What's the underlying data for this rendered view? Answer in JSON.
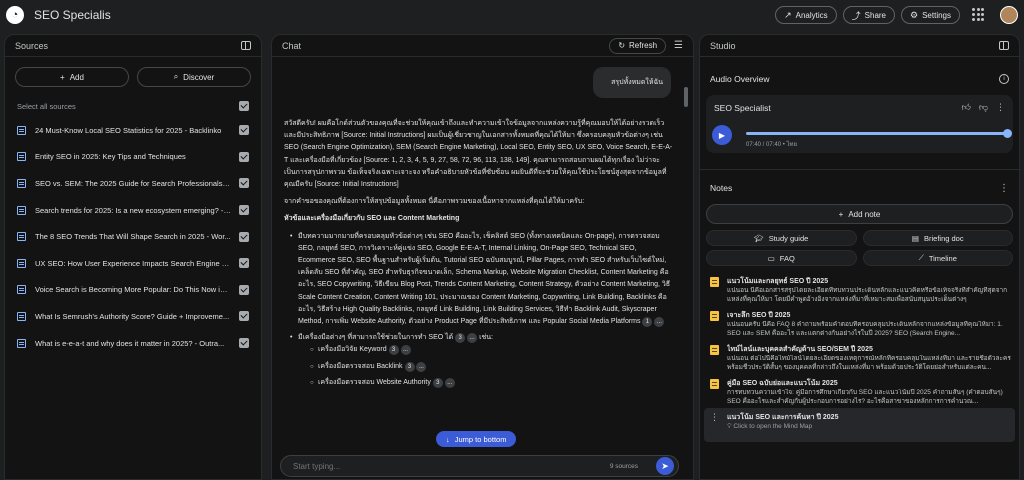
{
  "app": {
    "title": "SEO Specialis"
  },
  "topbar": {
    "analytics": "Analytics",
    "share": "Share",
    "settings": "Settings"
  },
  "sources": {
    "title": "Sources",
    "add_label": "Add",
    "discover_label": "Discover",
    "select_all": "Select all sources",
    "items": [
      "24 Must-Know Local SEO Statistics for 2025 - Backlinko",
      "Entity SEO in 2025: Key Tips and Techniques",
      "SEO vs. SEM: The 2025 Guide for Search Professionals - ...",
      "Search trends for 2025: Is a new ecosystem emerging? - ...",
      "The 8 SEO Trends That Will Shape Search in 2025 - Wor...",
      "UX SEO: How User Experience Impacts Search Engine R...",
      "Voice Search is Becoming More Popular: Do This Now in ...",
      "What Is Semrush's Authority Score? Guide + Improveme...",
      "What is e-e-a-t and why does it matter in 2025? - Outra..."
    ]
  },
  "chat": {
    "title": "Chat",
    "refresh": "Refresh",
    "user_message": "สรุปทั้งหมดให้ฉัน",
    "intro": "สวัสดีครับ! ผมคือโกด์ส่วนตัวของคุณที่จะช่วยให้คุณเข้าถึงและทำความเข้าใจข้อมูลจากแหล่งความรู้ที่คุณมอบให้ได้อย่างรวดเร็วและมีประสิทธิภาพ [Source: Initial Instructions] ผมเป็นผู้เชี่ยวชาญในเอกสารทั้งหมดที่คุณได้ให้มา ซึ่งครอบคลุมหัวข้อต่างๆ เช่น SEO (Search Engine Optimization), SEM (Search Engine Marketing), Local SEO, Entity SEO, UX SEO, Voice Search, E-E-A-T และเครื่องมือที่เกี่ยวข้อง [Source: 1, 2, 3, 4, 5, 9, 27, 58, 72, 96, 113, 138, 149]. คุณสามารถสอบถามผมได้ทุกเรื่อง ไม่ว่าจะเป็นการสรุปภาพรวม ข้อเท็จจริงเฉพาะเจาะจง หรือคำอธิบายหัวข้อที่ซับซ้อน ผมยินดีที่จะช่วยให้คุณใช้ประโยชน์สูงสุดจากข้อมูลที่คุณมีครับ [Source: Initial Instructions]",
    "summary_lead": "จากคำขอของคุณที่ต้องการให้สรุปข้อมูลทั้งหมด นี่คือภาพรวมของเนื้อหาจากแหล่งที่คุณได้ให้มาครับ:",
    "section_heading": "หัวข้อและเครื่องมือเกี่ยวกับ SEO และ Content Marketing",
    "bullet1": "มีบทความมากมายที่ครอบคลุมหัวข้อต่างๆ เช่น SEO คืออะไร, เช็คลิสต์ SEO (ทั้งทางเทคนิคและ On-page), การตรวจสอบ SEO, กลยุทธ์ SEO, การวิเคราะห์คู่แข่ง SEO, Google E-E-A-T, Internal Linking, On-Page SEO, Technical SEO, Ecommerce SEO, SEO พื้นฐานสำหรับผู้เริ่มต้น, Tutorial SEO ฉบับสมบูรณ์, Pillar Pages, การทำ SEO สำหรับเว็บไซต์ใหม่, เคล็ดลับ SEO ที่สำคัญ, SEO สำหรับธุรกิจขนาดเล็ก, Schema Markup, Website Migration Checklist, Content Marketing คืออะไร, SEO Copywriting, วิธีเขียน Blog Post, Trends Content Marketing, Content Strategy, ตัวอย่าง Content Marketing, วิธี Scale Content Creation, Content Writing 101, ประมาณของ Content Marketing, Copywriting, Link Building, Backlinks คืออะไร, วิธีสร้าง High Quality Backlinks, กลยุทธ์ Link Building, Link Building Services, วิธีทำ Backlink Audit, Skyscraper Method, การเพิ่ม Website Authority, ตัวอย่าง Product Page ที่มีประสิทธิภาพ และ Popular Social Media Platforms",
    "bullet1_cite": "1",
    "bullet2": "มีเครื่องมือต่างๆ ที่สามารถใช้ช่วยในการทำ SEO ได้",
    "bullet2_cite": "3",
    "bullet2_suffix": "เช่น:",
    "sub1": "เครื่องมือวิจัย Keyword",
    "sub1_cite": "3",
    "sub2": "เครื่องมือตรวจสอบ Backlink",
    "sub2_cite": "3",
    "sub3": "เครื่องมือตรวจสอบ Website Authority",
    "sub3_cite": "3",
    "more": "...",
    "jump_label": "Jump to bottom",
    "input_placeholder": "Start typing...",
    "source_count": "9 sources"
  },
  "studio": {
    "title": "Studio",
    "audio_overview": "Audio Overview",
    "audio_title": "SEO Specialist",
    "audio_time": "07:40 / 07:40 • ไทย",
    "progress": 1.0,
    "notes_title": "Notes",
    "add_note": "Add note",
    "study_guide": "Study guide",
    "briefing_doc": "Briefing doc",
    "faq": "FAQ",
    "timeline": "Timeline",
    "notes": [
      {
        "title": "แนวโน้มและกลยุทธ์ SEO ปี 2025",
        "desc": "แน่นอน นี่คือเอกสารสรุปโดยละเอียดที่ทบทวนประเด็นหลักและแนวคิดหรือข้อเท็จจริงที่สำคัญที่สุดจากแหล่งที่คุณให้มา โดยมีคำพูดอ้างอิงจากแหล่งที่มาที่เหมาะสมเพื่อสนับสนุนประเด็นต่างๆ"
      },
      {
        "title": "เจาะลึก SEO ปี 2025",
        "desc": "แน่นอนครับ นี่คือ FAQ 8 คำถามพร้อมคำตอบที่ครอบคลุมประเด็นหลักจากแหล่งข้อมูลที่คุณให้มา: 1. SEO และ SEM คืออะไร และแตกต่างกันอย่างไรในปี 2025? SEO (Search Engine..."
      },
      {
        "title": "ไทม์ไลน์และบุคคลสำคัญด้าน SEO/SEM ปี 2025",
        "desc": "แน่นอน ต่อไปนี้คือไทม์ไลน์โดยละเอียดของเหตุการณ์หลักที่ครอบคลุมในแหล่งที่มา และรายชื่อตัวละครพร้อมชีวประวัติสั้นๆ ของบุคคลที่กล่าวถึงในแหล่งที่มา พร้อมด้วยประวัติโดยย่อสำหรับแต่ละคน..."
      },
      {
        "title": "คู่มือ SEO ฉบับย่อและแนวโน้ม 2025",
        "desc": "การทบทวนความเข้าใจ: คู่มือการศึกษาเกี่ยวกับ SEO และแนวโน้มปี 2025 คำถามสั้นๆ (คำตอบสั้นๆ) SEO คืออะไรและสำคัญกับผู้ประกอบการอย่างไร? อะไรคือสาขาของหลักการการคำนวณ..."
      }
    ],
    "mindmap": {
      "title": "แนวโน้ม SEO และการค้นหา ปี 2025",
      "desc": "Click to open the Mind Map"
    }
  }
}
